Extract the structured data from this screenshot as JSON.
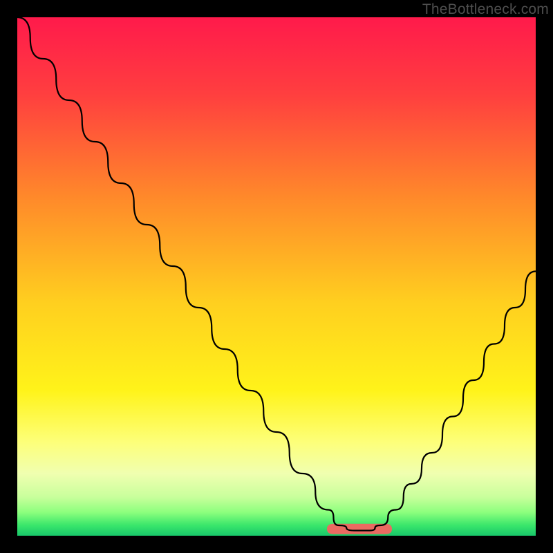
{
  "watermark": "TheBottleneck.com",
  "chart_data": {
    "type": "line",
    "title": "",
    "xlabel": "",
    "ylabel": "",
    "xlim": [
      0,
      100
    ],
    "ylim": [
      0,
      100
    ],
    "grid": false,
    "legend": false,
    "series": [
      {
        "name": "bottleneck-curve",
        "x": [
          0,
          5,
          10,
          15,
          20,
          25,
          30,
          35,
          40,
          45,
          50,
          55,
          60,
          62,
          65,
          68,
          70,
          73,
          76,
          80,
          84,
          88,
          92,
          96,
          100
        ],
        "values": [
          100,
          92,
          84,
          76,
          68,
          60,
          52,
          44,
          36,
          28,
          20,
          12,
          5,
          2,
          1,
          1,
          2,
          5,
          10,
          16,
          23,
          30,
          37,
          44,
          51
        ]
      }
    ],
    "highlight_band": {
      "name": "optimal-range",
      "x_start": 61,
      "x_end": 71,
      "color": "#ea6a61"
    },
    "background_gradient": {
      "stops": [
        {
          "pct": 0,
          "color": "#ff1a4b"
        },
        {
          "pct": 15,
          "color": "#ff3f3f"
        },
        {
          "pct": 35,
          "color": "#ff8a2a"
        },
        {
          "pct": 55,
          "color": "#ffcf1f"
        },
        {
          "pct": 72,
          "color": "#fff31a"
        },
        {
          "pct": 82,
          "color": "#fdff7a"
        },
        {
          "pct": 88,
          "color": "#f0ffb0"
        },
        {
          "pct": 92.5,
          "color": "#c9ff9c"
        },
        {
          "pct": 95.5,
          "color": "#8cff7d"
        },
        {
          "pct": 98,
          "color": "#39e66b"
        },
        {
          "pct": 100,
          "color": "#18c76a"
        }
      ]
    }
  }
}
